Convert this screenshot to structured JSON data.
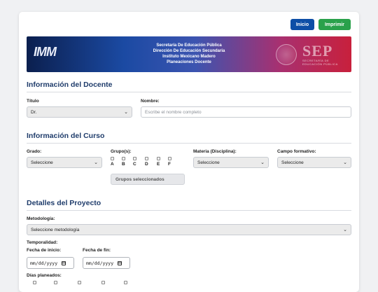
{
  "header": {
    "inicio_label": "Inicio",
    "imprimir_label": "Imprimir"
  },
  "banner": {
    "lines": [
      "Secretaría De Educación Pública",
      "Dirección De Educación Secundaria",
      "Instituto Mexicano Madero",
      "Planeaciones Docente"
    ],
    "left_logo": "IMM",
    "right_logo": "SEP",
    "right_logo_sub_1": "SECRETARÍA DE",
    "right_logo_sub_2": "EDUCACIÓN PÚBLICA"
  },
  "docente": {
    "heading": "Información del Docente",
    "titulo_label": "Título",
    "titulo_value": "Dr.",
    "nombre_label": "Nombre:",
    "nombre_placeholder": "Escribe el nombre completo"
  },
  "curso": {
    "heading": "Información del Curso",
    "grado_label": "Grado:",
    "grado_value": "Seleccione",
    "grupos_label": "Grupo(s):",
    "grupos": [
      "A",
      "B",
      "C",
      "D",
      "E",
      "F"
    ],
    "grupos_seleccionados": "Grupos seleccionados",
    "materia_label": "Materia (Disciplina):",
    "materia_value": "Seleccione",
    "campo_label": "Campo formativo:",
    "campo_value": "Seleccione"
  },
  "proyecto": {
    "heading": "Detalles del Proyecto",
    "metodologia_label": "Metodología:",
    "metodologia_value": "Seleccione metodología",
    "temporalidad_label": "Temporalidad:",
    "fecha_inicio_label": "Fecha de inicio:",
    "fecha_inicio_value": "mm/dd/yyyy",
    "fecha_fin_label": "Fecha de fin:",
    "fecha_fin_value": "mm/dd/yyyy",
    "dias_label": "Días planeados:"
  },
  "colors": {
    "primary": "#0d4ea6",
    "success": "#2aa14b",
    "heading": "#1f3c6b"
  }
}
